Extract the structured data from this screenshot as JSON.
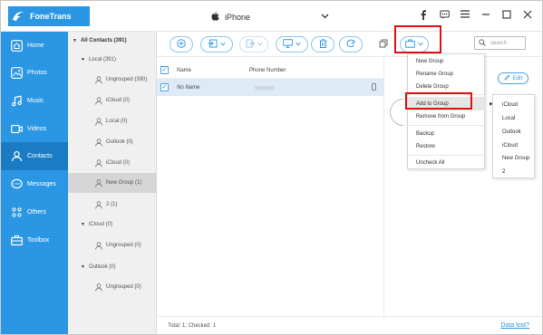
{
  "app": {
    "name": "FoneTrans",
    "device": "iPhone"
  },
  "window_controls": [
    "facebook-icon",
    "feedback-icon",
    "menu-icon",
    "minimize-icon",
    "maximize-icon",
    "close-icon"
  ],
  "colors": {
    "accent": "#2b97e4",
    "sidebar_active": "#1a7cc4",
    "highlight": "#e01010",
    "selected_row": "#deebf7"
  },
  "sidebar": {
    "items": [
      {
        "label": "Home",
        "icon": "home-icon"
      },
      {
        "label": "Photos",
        "icon": "photos-icon"
      },
      {
        "label": "Music",
        "icon": "music-icon"
      },
      {
        "label": "Videos",
        "icon": "videos-icon"
      },
      {
        "label": "Contacts",
        "icon": "contacts-icon",
        "active": true
      },
      {
        "label": "Messages",
        "icon": "messages-icon"
      },
      {
        "label": "Others",
        "icon": "others-icon"
      },
      {
        "label": "Toolbox",
        "icon": "toolbox-icon"
      }
    ]
  },
  "tree": {
    "all": "All Contacts  (391)",
    "rows": [
      {
        "label": "Local  (391)",
        "level": 1,
        "expander": true
      },
      {
        "label": "Ungrouped  (390)",
        "level": 2
      },
      {
        "label": "iCloud  (0)",
        "level": 2
      },
      {
        "label": "Local  (0)",
        "level": 2
      },
      {
        "label": "Outlook  (0)",
        "level": 2
      },
      {
        "label": "iCloud  (0)",
        "level": 2
      },
      {
        "label": "New Group  (1)",
        "level": 2,
        "selected": true
      },
      {
        "label": "2  (1)",
        "level": 2
      },
      {
        "label": "iCloud  (0)",
        "level": 1,
        "expander": true
      },
      {
        "label": "Ungrouped  (0)",
        "level": 2
      },
      {
        "label": "Outlook  (0)",
        "level": 1,
        "expander": true
      },
      {
        "label": "Ungrouped  (0)",
        "level": 2
      }
    ]
  },
  "search": {
    "placeholder": "search"
  },
  "list": {
    "headers": {
      "name": "Name",
      "phone": "Phone Number"
    },
    "rows": [
      {
        "name": "No Name",
        "phone": ""
      }
    ]
  },
  "detail": {
    "edit_label": "Edit"
  },
  "context_menu": {
    "items": [
      "New Group",
      "Rename Group",
      "Delete Group",
      "Add to Group",
      "Remove from Group",
      "Backup",
      "Restore",
      "Uncheck All"
    ],
    "highlighted": "Add to Group"
  },
  "submenu": {
    "items": [
      "iCloud",
      "Local",
      "Outlook",
      "iCloud",
      "New Group",
      "2"
    ]
  },
  "status": {
    "summary": "Total: 1; Checked: 1",
    "link": "Data lost?"
  }
}
